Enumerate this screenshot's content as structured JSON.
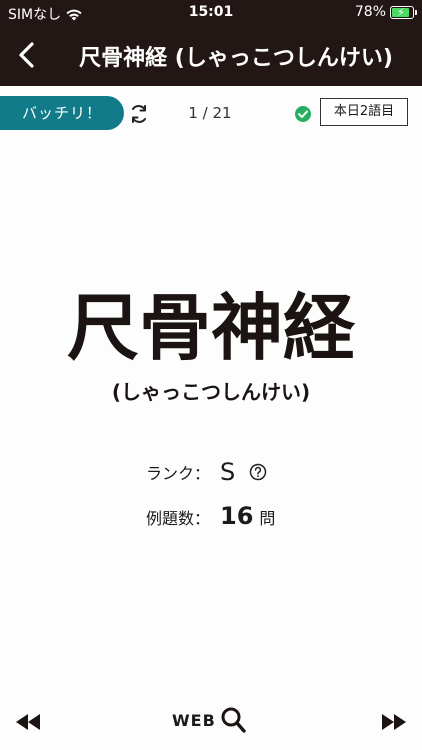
{
  "status_bar": {
    "carrier": "SIMなし",
    "time": "15:01",
    "battery_percent": "78%",
    "battery_level": 0.78,
    "wifi_icon": "wifi-icon",
    "battery_color": "#4cd964"
  },
  "nav": {
    "title": "尺骨神経 (しゃっこつしんけい)",
    "back_icon": "chevron-left-icon",
    "background_color": "#231715"
  },
  "toolbar": {
    "batchiri_label": "バッチリ！",
    "batchiri_color": "#127b8a",
    "counter": "1 / 21",
    "today_label": "本日2語目",
    "refresh_icon": "refresh-icon",
    "check_icon": "check-circle-icon",
    "check_color": "#27ae60"
  },
  "card": {
    "term": "尺骨神経",
    "reading": "(しゃっこつしんけい)",
    "rank_label": "ランク：",
    "rank_value": "S",
    "help_icon": "question-circle-icon",
    "example_label": "例題数：",
    "example_count": "16",
    "example_unit": "問"
  },
  "bottom_bar": {
    "prev_icon": "rewind-icon",
    "web_label": "WEB",
    "search_icon": "search-icon",
    "next_icon": "fast-forward-icon"
  }
}
